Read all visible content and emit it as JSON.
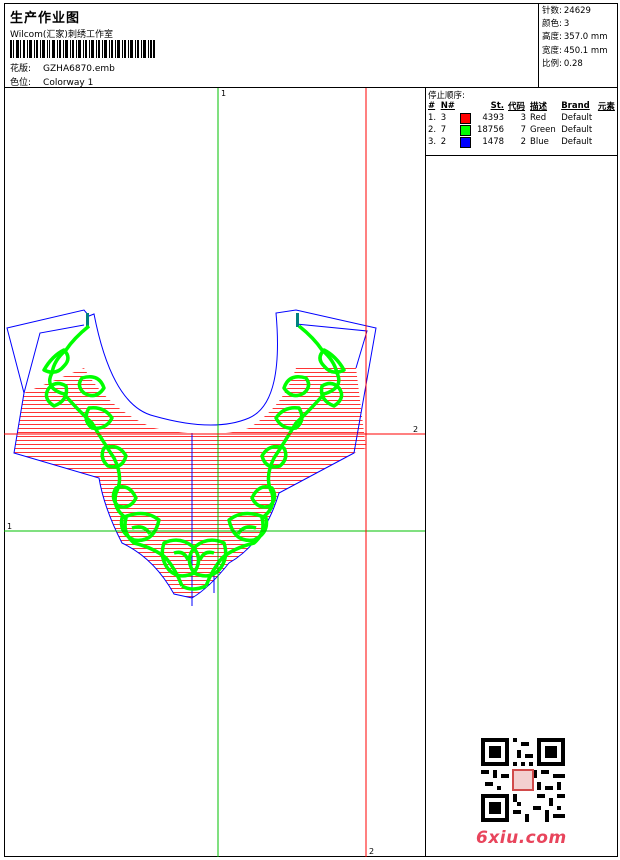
{
  "header": {
    "title": "生产作业图",
    "studio": "Wilcom(汇家)刺绣工作室",
    "design_label": "花版:",
    "design_value": "GZHA6870.emb",
    "colorway_label": "色位:",
    "colorway_value": "Colorway 1"
  },
  "stats": [
    {
      "label": "针数:",
      "value": "24629"
    },
    {
      "label": "颜色:",
      "value": "3"
    },
    {
      "label": "高度:",
      "value": "357.0 mm"
    },
    {
      "label": "宽度:",
      "value": "450.1 mm"
    },
    {
      "label": "比例:",
      "value": "0.28"
    }
  ],
  "sequence": {
    "title": "停止顺序:",
    "headers": [
      "#",
      "N#",
      "",
      "St.",
      "代码",
      "描述",
      "Brand",
      "元素"
    ],
    "rows": [
      {
        "num": "1.",
        "needle": "3",
        "color": "#ff0000",
        "stitches": "4393",
        "code": "3",
        "desc": "Red",
        "brand": "Default"
      },
      {
        "num": "2.",
        "needle": "7",
        "color": "#00ff00",
        "stitches": "18756",
        "code": "7",
        "desc": "Green",
        "brand": "Default"
      },
      {
        "num": "3.",
        "needle": "2",
        "color": "#0000ff",
        "stitches": "1478",
        "code": "2",
        "desc": "Blue",
        "brand": "Default"
      }
    ]
  },
  "guides": {
    "green_top_label": "1",
    "green_left_label": "1",
    "red_right_label": "2",
    "red_bottom_label": "2"
  },
  "colors": {
    "outline": "#0000ff",
    "fill": "#ff0000",
    "motif": "#00ff00",
    "brand": "#e8455c"
  },
  "watermark": {
    "text": "6xiu.com"
  }
}
